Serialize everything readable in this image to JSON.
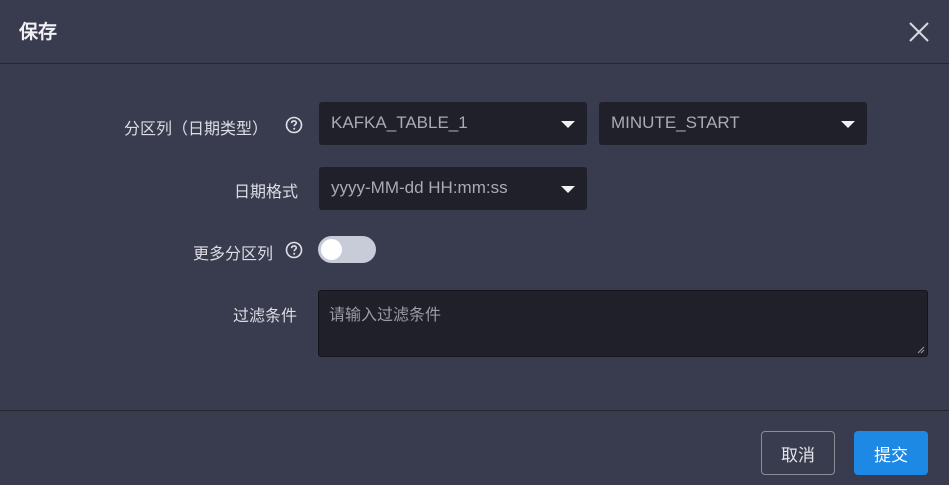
{
  "dialog": {
    "title": "保存"
  },
  "form": {
    "partition_column": {
      "label": "分区列（日期类型）",
      "table_value": "KAFKA_TABLE_1",
      "column_value": "MINUTE_START"
    },
    "date_format": {
      "label": "日期格式",
      "value": "yyyy-MM-dd HH:mm:ss"
    },
    "more_partitions": {
      "label": "更多分区列",
      "enabled": false
    },
    "filter": {
      "label": "过滤条件",
      "placeholder": "请输入过滤条件"
    }
  },
  "footer": {
    "cancel_label": "取消",
    "submit_label": "提交"
  },
  "colors": {
    "background": "#393c4f",
    "input_background": "#1f2029",
    "primary": "#1e88e5"
  },
  "icons": [
    "close-icon",
    "help-icon",
    "caret-down-icon"
  ]
}
